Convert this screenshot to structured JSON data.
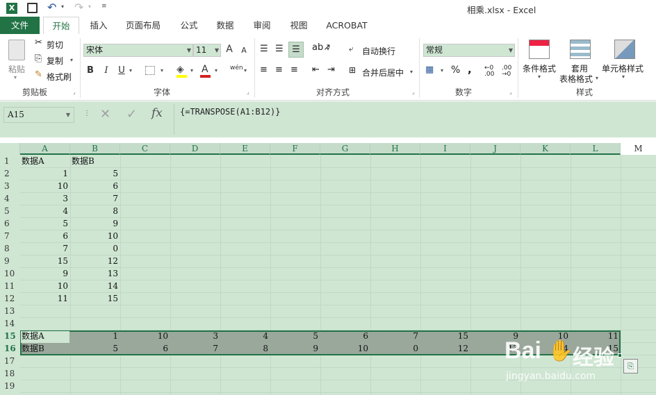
{
  "title": {
    "text": "相乘.xlsx - Excel"
  },
  "tabs": {
    "file": "文件",
    "home": "开始",
    "insert": "插入",
    "layout": "页面布局",
    "formulas": "公式",
    "data": "数据",
    "review": "审阅",
    "view": "视图",
    "acrobat": "ACROBAT"
  },
  "clipboard": {
    "paste": "粘贴",
    "cut": "剪切",
    "copy": "复制",
    "painter": "格式刷",
    "label": "剪贴板"
  },
  "font": {
    "name": "宋体",
    "size": "11",
    "label": "字体",
    "bold": "B",
    "italic": "I",
    "underline": "U",
    "grow": "A",
    "shrink": "A",
    "phonetic": "wén"
  },
  "align": {
    "wrap": "自动换行",
    "merge": "合并后居中",
    "label": "对齐方式"
  },
  "number": {
    "format": "常规",
    "percent": "%",
    "comma": ",",
    "label": "数字"
  },
  "styles": {
    "cond": "条件格式",
    "table1": "套用",
    "table2": "表格格式",
    "cell": "单元格样式",
    "label": "样式"
  },
  "formula_bar": {
    "name_box": "A15",
    "fx": "fx",
    "formula": "{=TRANSPOSE(A1:B12)}"
  },
  "columns": [
    "A",
    "B",
    "C",
    "D",
    "E",
    "F",
    "G",
    "H",
    "I",
    "J",
    "K",
    "L",
    "M"
  ],
  "rows": [
    "1",
    "2",
    "3",
    "4",
    "5",
    "6",
    "7",
    "8",
    "9",
    "10",
    "11",
    "12",
    "13",
    "14",
    "15",
    "16",
    "17",
    "18",
    "19"
  ],
  "data_header": {
    "a": "数据A",
    "b": "数据B"
  },
  "data_a": [
    "1",
    "10",
    "3",
    "4",
    "5",
    "6",
    "7",
    "15",
    "9",
    "10",
    "11"
  ],
  "data_b": [
    "5",
    "6",
    "7",
    "8",
    "9",
    "10",
    "0",
    "12",
    "13",
    "14",
    "15"
  ],
  "row15": [
    "数据A",
    "1",
    "10",
    "3",
    "4",
    "5",
    "6",
    "7",
    "15",
    "9",
    "10",
    "11"
  ],
  "row16": [
    "数据B",
    "5",
    "6",
    "7",
    "8",
    "9",
    "10",
    "0",
    "12",
    "13",
    "14",
    "15"
  ],
  "watermark": {
    "brand": "Bai",
    "suffix": "经验",
    "url": "jingyan.baidu.com"
  },
  "colors": {
    "excel_green": "#217346",
    "sheet_bg": "#cfe6d3",
    "selection": "#9aa89c"
  }
}
